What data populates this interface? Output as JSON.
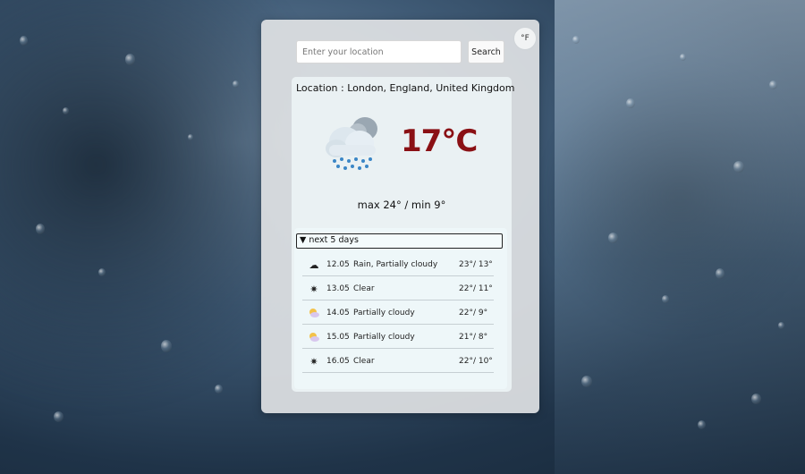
{
  "header": {
    "unit_toggle_label": "°F",
    "search_placeholder": "Enter your location",
    "search_button_label": "Search"
  },
  "current": {
    "location_label": "Location",
    "location_value": "London, England, United Kingdom",
    "temperature": "17°C",
    "max_min": "max 24° / min 9°",
    "icon": "cloud-rain-icon"
  },
  "forecast": {
    "summary_label": "next 5 days",
    "days": [
      {
        "date": "12.05",
        "description": "Rain, Partially cloudy",
        "temps": "23°/ 13°",
        "icon": "cloud-rain-icon"
      },
      {
        "date": "13.05",
        "description": "Clear",
        "temps": "22°/ 11°",
        "icon": "sun-icon"
      },
      {
        "date": "14.05",
        "description": "Partially cloudy",
        "temps": "22°/ 9°",
        "icon": "partly-cloudy-icon"
      },
      {
        "date": "15.05",
        "description": "Partially cloudy",
        "temps": "21°/ 8°",
        "icon": "partly-cloudy-icon"
      },
      {
        "date": "16.05",
        "description": "Clear",
        "temps": "22°/ 10°",
        "icon": "sun-icon"
      }
    ]
  },
  "colors": {
    "temperature": "#8a1014",
    "card_background": "#e0e2e4",
    "panel_background": "#eaf1f3"
  }
}
